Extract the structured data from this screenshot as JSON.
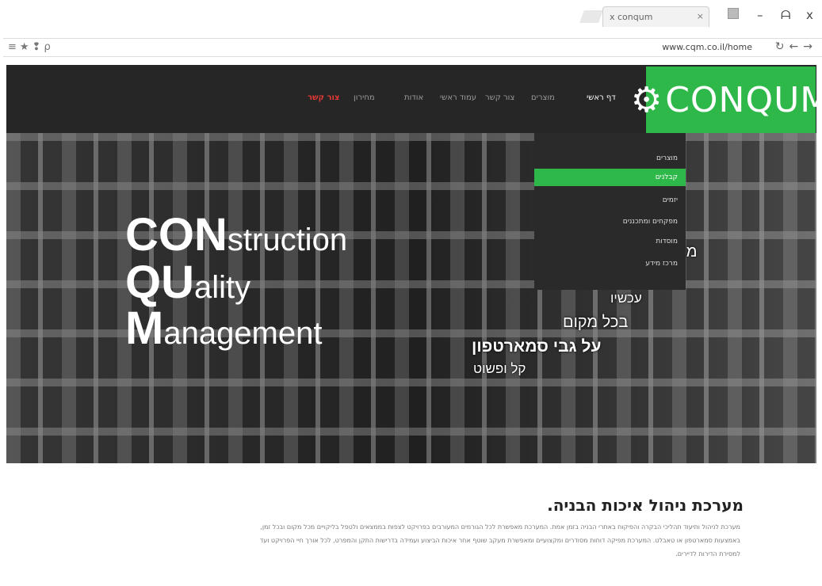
{
  "browser": {
    "tab_title": "x conqum",
    "tab_close": "×",
    "url": "www.cqm.co.il/home",
    "controls": {
      "minimize": "–",
      "maximize": "ᗩ",
      "close": "x"
    },
    "left_icons": "≡★❢ρ",
    "right_icons": "↻←→"
  },
  "nav": {
    "logo": "CONQUM",
    "items": [
      "צור קשר",
      "מחירון",
      "אודות",
      "עמוד ראשי",
      "צור קשר",
      "מוצרים",
      "דף ראשי"
    ],
    "colors": {
      "bar": "#262626",
      "logo_bg": "#2fb84a",
      "active": "#e53935"
    }
  },
  "dropdown": {
    "items": [
      "מוצרים",
      "קבלנים",
      "יזמים",
      "מפקחים ומתכננים",
      "מוסדות",
      "מרכז מידע"
    ],
    "active_index": 1
  },
  "hero": {
    "title_lines": [
      {
        "big": "CON",
        "small": "struction"
      },
      {
        "big": "QU",
        "small": "ality"
      },
      {
        "big": "M",
        "small": "anagement"
      }
    ],
    "hebrew_lines": [
      "מנ",
      "עכשיו",
      "בכל מקום",
      "על גבי סמארטפון",
      "קל ופשוט"
    ]
  },
  "content": {
    "title": "מערכת ניהול איכות הבניה.",
    "paragraph": "מערכת לניהול ותיעוד תהליכי הבקרה והפיקוח באתרי הבניה בזמן אמת. המערכת מאפשרת לכל הגורמים המעורבים בפרויקט לצפות בממצאים ולטפל בליקויים מכל מקום ובכל זמן, באמצעות סמארטפון או טאבלט. המערכת מפיקה דוחות מסודרים ומקצועיים ומאפשרת מעקב שוטף אחר איכות הביצוע ועמידה בדרישות התקן והמפרט, לכל אורך חיי הפרויקט ועד למסירת הדירות לדיירים."
  }
}
